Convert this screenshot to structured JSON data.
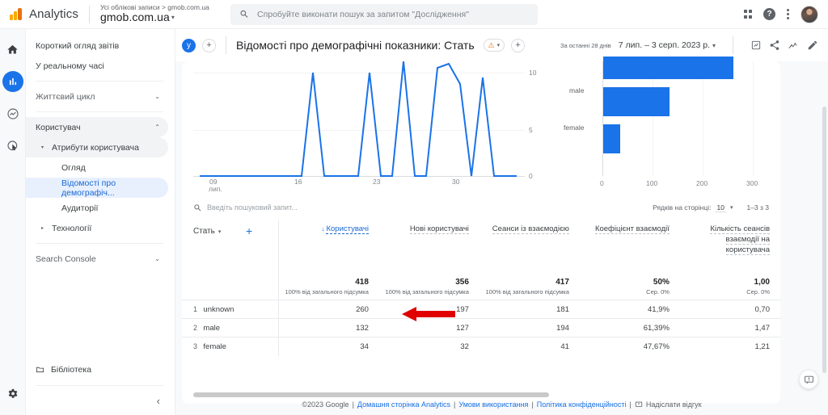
{
  "header": {
    "brand": "Analytics",
    "account_breadcrumb": "Усі облікові записи > gmob.com.ua",
    "account_name": "gmob.com.ua",
    "account_caret": "▾",
    "search_placeholder": "Спробуйте виконати пошук за запитом \"Дослідження\"",
    "search_value": "",
    "icons": {
      "apps": "apps-grid-icon",
      "help": "?",
      "more": "more-vert-icon",
      "avatar": "user-avatar"
    }
  },
  "rail": {
    "items": [
      {
        "name": "home",
        "label": "Головна"
      },
      {
        "name": "reports",
        "label": "Звіти",
        "active": true
      },
      {
        "name": "explore",
        "label": "Дослідження"
      },
      {
        "name": "advertising",
        "label": "Реклама"
      }
    ],
    "settings_label": "Адміністратор"
  },
  "sidebar": {
    "items": [
      {
        "label": "Короткий огляд звітів",
        "type": "plain"
      },
      {
        "label": "У реальному часі",
        "type": "plain"
      },
      {
        "label": "Життєвий цикл",
        "type": "group",
        "chevron": "⌄"
      },
      {
        "label": "Користувач",
        "type": "group-open",
        "chevron": "⌃"
      },
      {
        "label": "Атрибути користувача",
        "type": "sub-open",
        "tri": "▾"
      },
      {
        "label": "Огляд",
        "type": "leaf"
      },
      {
        "label": "Відомості про демографіч...",
        "type": "leaf-selected"
      },
      {
        "label": "Аудиторії",
        "type": "leaf"
      },
      {
        "label": "Технології",
        "type": "sub",
        "tri": "▸"
      },
      {
        "label": "Search Console",
        "type": "group",
        "chevron": "⌄"
      }
    ],
    "library_label": "Бібліотека",
    "collapse_icon": "‹"
  },
  "titlebar": {
    "profile_badge": "у",
    "add_comparison": "+",
    "page_title": "Відомості про демографічні показники: Стать",
    "warning_icon": "⚠",
    "warning_caret": "▾",
    "add_button": "+",
    "date_sublabel": "За останні 28 днів",
    "date_range": "7 лип. – 3 серп. 2023 р.",
    "date_caret": "▾",
    "actions": [
      "insights-icon",
      "share-icon",
      "compare-icon",
      "edit-icon"
    ]
  },
  "chart_data": [
    {
      "type": "line",
      "title": "",
      "x": [
        "07",
        "08",
        "09",
        "10",
        "11",
        "12",
        "13",
        "14",
        "15",
        "16",
        "17",
        "18",
        "19",
        "20",
        "21",
        "22",
        "23",
        "24",
        "25",
        "26",
        "27",
        "28",
        "29",
        "30",
        "31",
        "01",
        "02",
        "03"
      ],
      "values": [
        0,
        0,
        0,
        0,
        0,
        0,
        0,
        0,
        0,
        0,
        10,
        0,
        0,
        0,
        0,
        10,
        0,
        0,
        12,
        0,
        0,
        10.5,
        11.5,
        9,
        0,
        9.5,
        0,
        0
      ],
      "xlabel": "",
      "ylabel": "",
      "ylim": [
        0,
        12
      ],
      "yticks": [
        0,
        5,
        10
      ],
      "xticks": [
        "09",
        "16",
        "23",
        "30"
      ],
      "xtick_sublabel": "лип.",
      "grid": true,
      "color": "#1a73e8"
    },
    {
      "type": "bar",
      "orientation": "horizontal",
      "title": "",
      "categories": [
        "unknown",
        "male",
        "female"
      ],
      "values": [
        260,
        132,
        34
      ],
      "xlabel": "",
      "ylabel": "",
      "xlim": [
        0,
        300
      ],
      "xticks": [
        0,
        100,
        200,
        300
      ],
      "grid": true,
      "color": "#1a73e8"
    }
  ],
  "table": {
    "search_placeholder": "Введіть пошуковий запит...",
    "search_value": "",
    "rows_per_page_label": "Рядків на сторінці:",
    "rows_per_page_value": "10",
    "rows_per_page_caret": "▾",
    "range_label": "1–3 з 3",
    "dimension": "Стать",
    "dimension_caret": "▾",
    "add_dimension": "+",
    "columns": [
      {
        "label": "Користувачі",
        "sorted": true,
        "sort_icon": "↓"
      },
      {
        "label": "Нові користувачі",
        "sorted": false
      },
      {
        "label": "Сеанси із взаємодією",
        "sorted": false
      },
      {
        "label": "Коефіцієнт взаємодії",
        "sorted": false
      },
      {
        "label": "Кількість сеансів взаємодії на користувача",
        "sorted": false
      }
    ],
    "summary": [
      {
        "value": "418",
        "note": "100% від загального підсумка"
      },
      {
        "value": "356",
        "note": "100% від загального підсумка"
      },
      {
        "value": "417",
        "note": "100% від загального підсумка"
      },
      {
        "value": "50%",
        "note": "Сер. 0%"
      },
      {
        "value": "1,00",
        "note": "Сер. 0%"
      }
    ],
    "rows": [
      {
        "index": "1",
        "dimension": "unknown",
        "values": [
          "260",
          "197",
          "181",
          "41,9%",
          "0,70"
        ]
      },
      {
        "index": "2",
        "dimension": "male",
        "values": [
          "132",
          "127",
          "194",
          "61,39%",
          "1,47"
        ]
      },
      {
        "index": "3",
        "dimension": "female",
        "values": [
          "34",
          "32",
          "41",
          "47,67%",
          "1,21"
        ]
      }
    ]
  },
  "annotation": {
    "type": "red-arrow-left",
    "points_at": "260",
    "color": "#e00000"
  },
  "footer": {
    "copyright": "©2023 Google",
    "sep": "|",
    "links": [
      "Домашня сторінка Analytics",
      "Умови використання",
      "Політика конфіденційності"
    ],
    "feedback": "Надіслати відгук",
    "feedback_icon": "feedback-icon"
  }
}
